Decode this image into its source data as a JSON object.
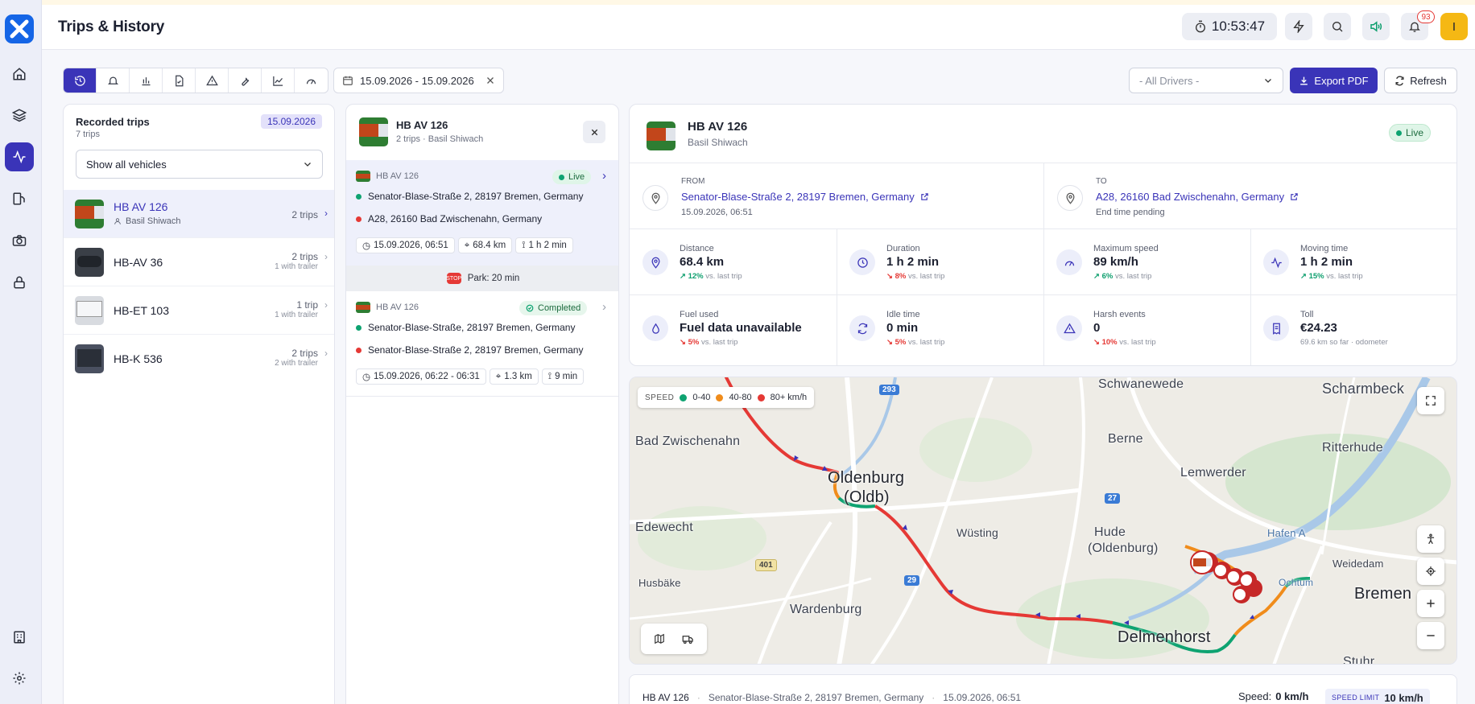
{
  "header": {
    "title": "Trips & History",
    "clock": "10:53:47",
    "notifications_count": "93",
    "avatar_initial": "I"
  },
  "toolbar": {
    "date_range": "15.09.2026 - 15.09.2026",
    "driver_select": "- All Drivers -",
    "export_label": "Export PDF",
    "refresh_label": "Refresh"
  },
  "recorded": {
    "title": "Recorded trips",
    "count": "7 trips",
    "date_badge": "15.09.2026",
    "vehicle_filter": "Show all vehicles",
    "vehicles": [
      {
        "name": "HB AV 126",
        "driver": "Basil Shiwach",
        "trips": "2 trips",
        "sub": ""
      },
      {
        "name": "HB-AV 36",
        "driver": "",
        "trips": "2 trips",
        "sub": "1 with trailer"
      },
      {
        "name": "HB-ET 103",
        "driver": "",
        "trips": "1 trip",
        "sub": "1 with trailer"
      },
      {
        "name": "HB-K 536",
        "driver": "",
        "trips": "2 trips",
        "sub": "2 with trailer"
      }
    ]
  },
  "trips_panel": {
    "vehicle": "HB AV 126",
    "sub": "2 trips · Basil Shiwach",
    "trips": [
      {
        "vehicle": "HB AV 126",
        "status": "Live",
        "from": "Senator-Blase-Straße 2, 28197 Bremen, Germany",
        "to": "A28, 26160 Bad Zwischenahn, Germany",
        "time": "15.09.2026, 06:51",
        "distance": "68.4 km",
        "duration": "1 h 2 min"
      },
      {
        "vehicle": "HB AV 126",
        "status": "Completed",
        "from": "Senator-Blase-Straße, 28197 Bremen, Germany",
        "to": "Senator-Blase-Straße 2, 28197 Bremen, Germany",
        "time": "15.09.2026, 06:22 - 06:31",
        "distance": "1.3 km",
        "duration": "9 min"
      }
    ],
    "park": "Park: 20 min"
  },
  "detail": {
    "vehicle": "HB AV 126",
    "driver": "Basil Shiwach",
    "status": "Live",
    "from_label": "FROM",
    "from": "Senator-Blase-Straße 2, 28197 Bremen, Germany",
    "from_time": "15.09.2026, 06:51",
    "to_label": "TO",
    "to": "A28, 26160 Bad Zwischenahn, Germany",
    "to_time": "End time pending",
    "stats": [
      {
        "label": "Distance",
        "value": "68.4 km",
        "delta": "12%",
        "dir": "up",
        "note": "vs. last trip",
        "icon": "pin-icon"
      },
      {
        "label": "Duration",
        "value": "1 h 2 min",
        "delta": "8%",
        "dir": "down",
        "note": "vs. last trip",
        "icon": "clock-icon"
      },
      {
        "label": "Maximum speed",
        "value": "89 km/h",
        "delta": "6%",
        "dir": "up",
        "note": "vs. last trip",
        "icon": "gauge-icon"
      },
      {
        "label": "Moving time",
        "value": "1 h 2 min",
        "delta": "15%",
        "dir": "up",
        "note": "vs. last trip",
        "icon": "activity-icon"
      },
      {
        "label": "Fuel used",
        "value": "Fuel data unavailable",
        "delta": "5%",
        "dir": "down",
        "note": "vs. last trip",
        "icon": "fuel-icon"
      },
      {
        "label": "Idle time",
        "value": "0 min",
        "delta": "5%",
        "dir": "down",
        "note": "vs. last trip",
        "icon": "refresh-icon"
      },
      {
        "label": "Harsh events",
        "value": "0",
        "delta": "10%",
        "dir": "down",
        "note": "vs. last trip",
        "icon": "warning-icon"
      },
      {
        "label": "Toll",
        "value": "€24.23",
        "delta": "",
        "dir": "",
        "note": "69.6 km so far · odometer",
        "icon": "receipt-icon"
      }
    ]
  },
  "map": {
    "legend_title": "SPEED",
    "legend": [
      {
        "label": "0-40",
        "color": "#0ea371"
      },
      {
        "label": "40-80",
        "color": "#f08c1b"
      },
      {
        "label": "80+ km/h",
        "color": "#e53935"
      }
    ],
    "places": [
      "Bad Zwischenahn",
      "Oldenburg",
      "(Oldb)",
      "Edewecht",
      "Husbäke",
      "Wardenburg",
      "Wüsting",
      "Hude",
      "(Oldenburg)",
      "Berne",
      "Lemwerder",
      "Schwanewede",
      "Scharmbeck",
      "Ritterhude",
      "Weidedam",
      "Delmenhorst",
      "Hafen A",
      "Ochtum",
      "Bremen",
      "Stuhr"
    ],
    "roads": [
      "293",
      "401",
      "29",
      "27"
    ]
  },
  "footer": {
    "vehicle": "HB AV 126",
    "address": "Senator-Blase-Straße 2, 28197 Bremen, Germany",
    "time": "15.09.2026, 06:51",
    "speed_label": "Speed:",
    "speed": "0 km/h",
    "limit_label": "SPEED LIMIT",
    "limit": "10 km/h"
  }
}
